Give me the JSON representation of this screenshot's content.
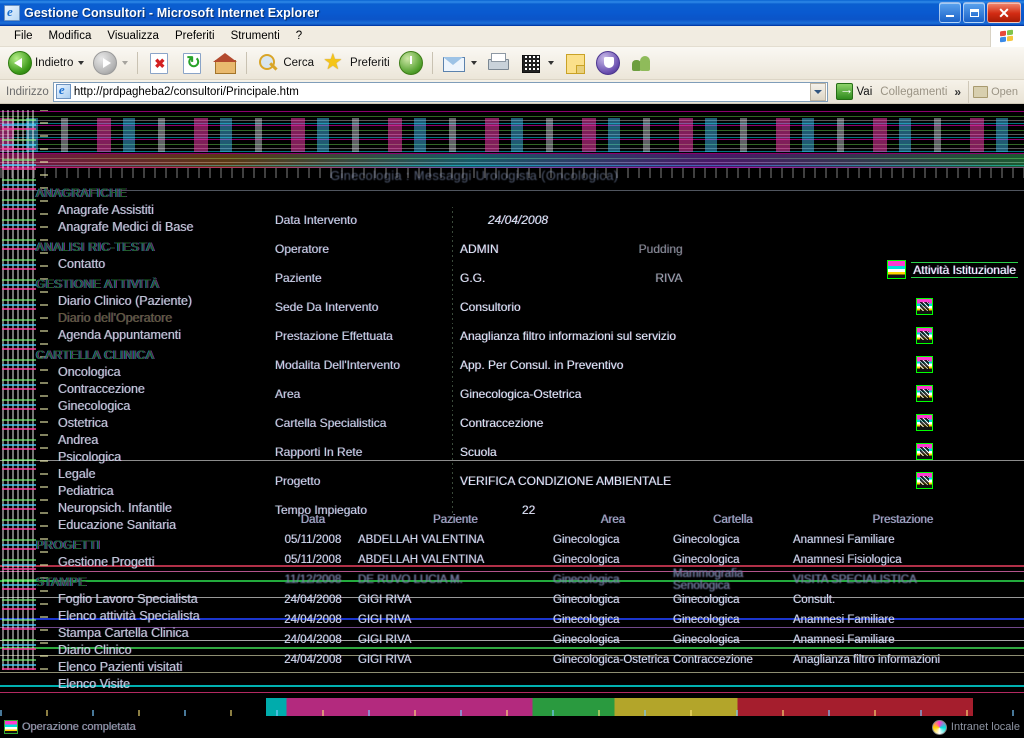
{
  "window": {
    "title": "Gestione Consultori - Microsoft Internet Explorer",
    "minimize_label": "",
    "maximize_label": "",
    "close_label": "✕"
  },
  "menubar": {
    "items": [
      {
        "label": "File"
      },
      {
        "label": "Modifica"
      },
      {
        "label": "Visualizza"
      },
      {
        "label": "Preferiti"
      },
      {
        "label": "Strumenti"
      },
      {
        "label": "?"
      }
    ]
  },
  "toolbar": {
    "back_label": "Indietro",
    "forward_label": "",
    "stop_label": "",
    "refresh_label": "",
    "home_label": "",
    "search_label": "Cerca",
    "favorites_label": "Preferiti",
    "history_label": "",
    "mail_label": "",
    "print_label": "",
    "edit_label": "",
    "note_label": "",
    "messenger_label": "",
    "people_label": ""
  },
  "address": {
    "label": "Indirizzo",
    "url": "http://prdpagheba2/consultori/Principale.htm",
    "go_label": "Vai",
    "links_label": "Collegamenti",
    "overflow_label": "»",
    "open_label": "Open"
  },
  "page": {
    "header_title": "Ginecologia : Messaggi Urologista (Oncologica)",
    "badge_label": "Attività Istituzionale"
  },
  "sidebar": {
    "groups": [
      {
        "heading": "ANAGRAFICHE",
        "items": [
          {
            "label": "Anagrafe Assistiti"
          },
          {
            "label": "Anagrafe Medici di Base"
          }
        ]
      },
      {
        "heading": "ANALISI RIC-TESTA",
        "items": [
          {
            "label": "Contatto"
          }
        ]
      },
      {
        "heading": "GESTIONE ATTIVITÀ",
        "items": [
          {
            "label": "Diario Clinico (Paziente)"
          },
          {
            "label": "Diario dell'Operatore",
            "dim": true
          },
          {
            "label": "Agenda Appuntamenti"
          }
        ]
      },
      {
        "heading": "CARTELLA CLINICA",
        "items": [
          {
            "label": "Oncologica"
          },
          {
            "label": "Contraccezione"
          },
          {
            "label": "Ginecologica"
          },
          {
            "label": "Ostetrica"
          },
          {
            "label": "Andrea"
          },
          {
            "label": "Psicologica"
          },
          {
            "label": "Legale"
          },
          {
            "label": "Pediatrica"
          },
          {
            "label": "Neuropsich. Infantile"
          },
          {
            "label": "Educazione Sanitaria"
          }
        ]
      },
      {
        "heading": "PROGETTI",
        "items": [
          {
            "label": "Gestione Progetti"
          }
        ]
      },
      {
        "heading": "STAMPE",
        "items": [
          {
            "label": "Foglio Lavoro Specialista"
          },
          {
            "label": "Elenco attività Specialista"
          },
          {
            "label": "Stampa Cartella Clinica"
          },
          {
            "label": "Diario Clinico"
          },
          {
            "label": "Elenco Pazienti visitati"
          },
          {
            "label": "Elenco Visite"
          }
        ]
      }
    ]
  },
  "form": {
    "rows": [
      {
        "label": "Data Intervento",
        "value": "24/04/2008",
        "kind": "date",
        "button": false
      },
      {
        "label": "Operatore",
        "value": "ADMIN",
        "kind": "plain",
        "button": false,
        "extra": "Pudding"
      },
      {
        "label": "Paziente",
        "value": "G.G.",
        "kind": "plain",
        "button": false,
        "extra": "RIVA"
      },
      {
        "label": "Sede Da Intervento",
        "value": "Consultorio",
        "kind": "plain",
        "button": true
      },
      {
        "label": "Prestazione Effettuata",
        "value": "Anaglianza filtro informazioni sul servizio",
        "kind": "plain",
        "button": true
      },
      {
        "label": "Modalita Dell'Intervento",
        "value": "App. Per Consul. in Preventivo",
        "kind": "plain",
        "button": true
      },
      {
        "label": "Area",
        "value": "Ginecologica-Ostetrica",
        "kind": "plain",
        "button": true
      },
      {
        "label": "Cartella Specialistica",
        "value": "Contraccezione",
        "kind": "plain",
        "button": true
      },
      {
        "label": "Rapporti In Rete",
        "value": "Scuola",
        "kind": "plain",
        "button": true
      },
      {
        "label": "Progetto",
        "value": "VERIFICA CONDIZIONE AMBIENTALE",
        "kind": "plain",
        "button": true
      },
      {
        "label": "Tempo Impiegato",
        "value": "22",
        "kind": "center",
        "button": false
      }
    ]
  },
  "table": {
    "headers": [
      "Data",
      "Paziente",
      "Area",
      "Cartella",
      "Prestazione"
    ],
    "rows": [
      {
        "data": "05/11/2008",
        "paziente": "ABDELLAH VALENTINA",
        "area": "Ginecologica",
        "cartella": "Ginecologica",
        "prestazione": "Anamnesi Familiare"
      },
      {
        "data": "05/11/2008",
        "paziente": "ABDELLAH VALENTINA",
        "area": "Ginecologica",
        "cartella": "Ginecologica",
        "prestazione": "Anamnesi Fisiologica"
      },
      {
        "data": "11/12/2008",
        "paziente": "DE RUVO LUCIA M.",
        "area": "Ginecologica",
        "cartella": "Mammografia Senologica",
        "prestazione": "VISITA SPECIALISTICA"
      },
      {
        "data": "24/04/2008",
        "paziente": "GIGI RIVA",
        "area": "Ginecologica",
        "cartella": "Ginecologica",
        "prestazione": "Consult."
      },
      {
        "data": "24/04/2008",
        "paziente": "GIGI RIVA",
        "area": "Ginecologica",
        "cartella": "Ginecologica",
        "prestazione": "Anamnesi Familiare"
      },
      {
        "data": "24/04/2008",
        "paziente": "GIGI RIVA",
        "area": "Ginecologica",
        "cartella": "Ginecologica",
        "prestazione": "Anamnesi Familiare"
      },
      {
        "data": "24/04/2008",
        "paziente": "GIGI RIVA",
        "area": "Ginecologica-Ostetrica",
        "cartella": "Contraccezione",
        "prestazione": "Anaglianza filtro informazioni"
      }
    ]
  },
  "statusbar": {
    "text": "Operazione completata",
    "zone": "Intranet locale"
  }
}
